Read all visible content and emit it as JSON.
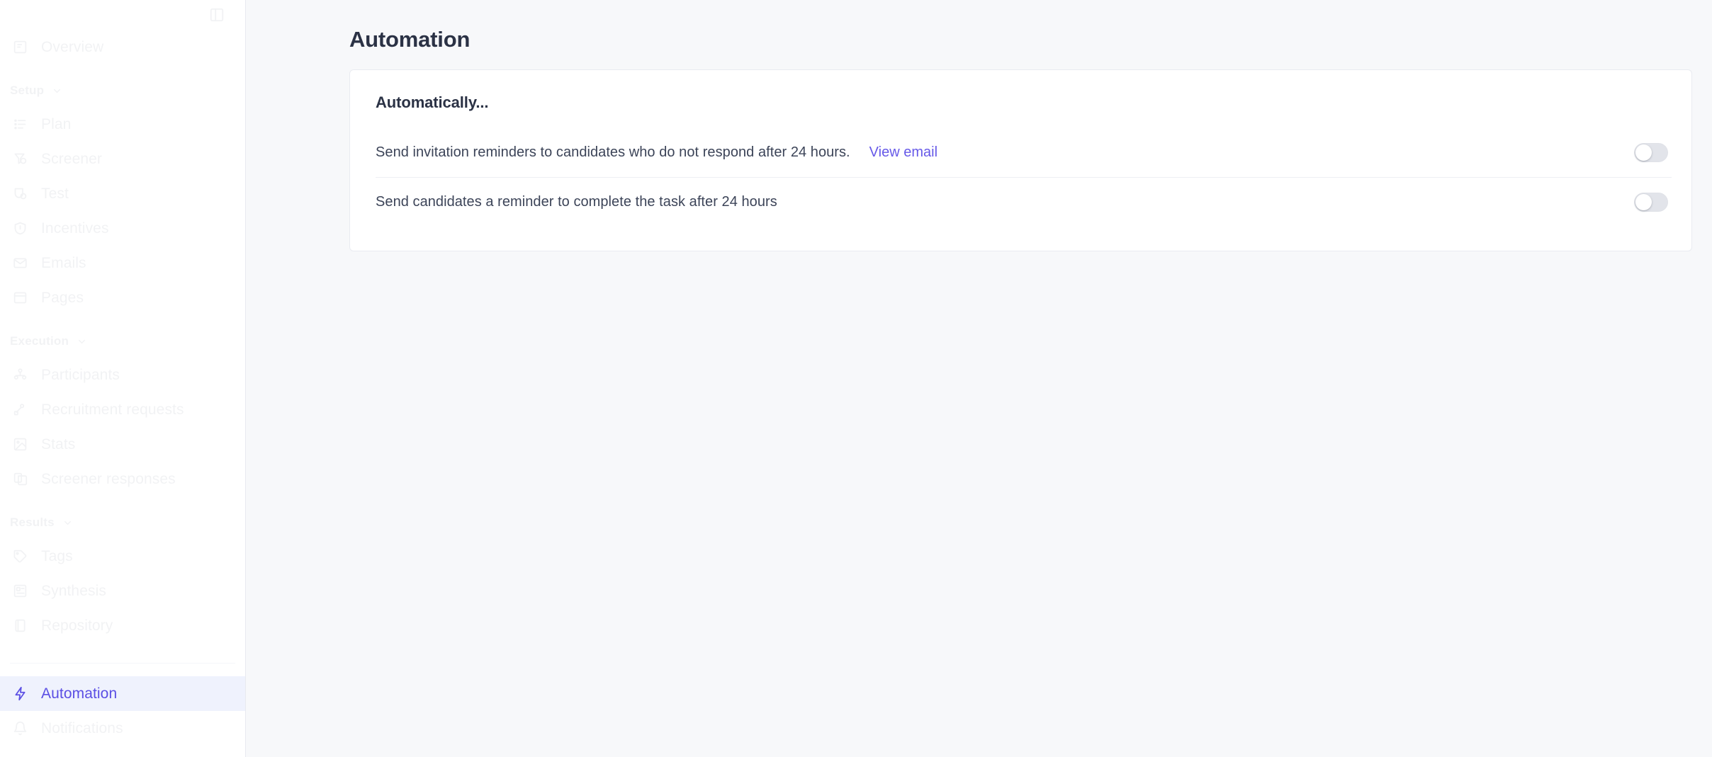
{
  "sidebar": {
    "panel_toggle_icon": "panel-layout-icon",
    "top_items": [
      {
        "label": "Overview",
        "icon": "document-icon",
        "active": false
      }
    ],
    "groups": [
      {
        "label": "Setup",
        "chevron": "chevron-down-icon",
        "items": [
          {
            "label": "Plan",
            "icon": "list-icon",
            "active": false
          },
          {
            "label": "Screener",
            "icon": "filter-funnel-icon",
            "active": false
          },
          {
            "label": "Test",
            "icon": "flask-icon",
            "active": false
          },
          {
            "label": "Incentives",
            "icon": "shield-icon",
            "active": false
          },
          {
            "label": "Emails",
            "icon": "envelope-icon",
            "active": false
          },
          {
            "label": "Pages",
            "icon": "window-icon",
            "active": false
          }
        ]
      },
      {
        "label": "Execution",
        "chevron": "chevron-down-icon",
        "items": [
          {
            "label": "Participants",
            "icon": "people-icon",
            "active": false
          },
          {
            "label": "Recruitment requests",
            "icon": "megaphone-icon",
            "active": false
          },
          {
            "label": "Stats",
            "icon": "image-chart-icon",
            "active": false
          },
          {
            "label": "Screener responses",
            "icon": "documents-icon",
            "active": false
          }
        ]
      },
      {
        "label": "Results",
        "chevron": "chevron-down-icon",
        "items": [
          {
            "label": "Tags",
            "icon": "tag-icon",
            "active": false
          },
          {
            "label": "Synthesis",
            "icon": "layers-icon",
            "active": false
          },
          {
            "label": "Repository",
            "icon": "book-icon",
            "active": false
          }
        ]
      }
    ],
    "bottom_items": [
      {
        "label": "Automation",
        "icon": "lightning-bolt-icon",
        "active": true
      },
      {
        "label": "Notifications",
        "icon": "bell-icon",
        "active": false
      }
    ]
  },
  "main": {
    "page_title": "Automation",
    "card": {
      "heading": "Automatically...",
      "rules": [
        {
          "text": "Send invitation reminders to candidates who do not respond after 24 hours.",
          "link_label": "View email",
          "toggle_on": false
        },
        {
          "text": "Send candidates a reminder to complete the task after 24 hours",
          "link_label": "",
          "toggle_on": false
        }
      ]
    }
  },
  "colors": {
    "accent": "#5b4fe4",
    "link": "#6659e8",
    "active_nav_bg": "#eff2fd",
    "page_bg": "#f7f8fa",
    "card_bg": "#ffffff",
    "text_primary": "#2b3245",
    "text_body": "#3c4458",
    "toggle_off_track": "#e2e4ea"
  }
}
